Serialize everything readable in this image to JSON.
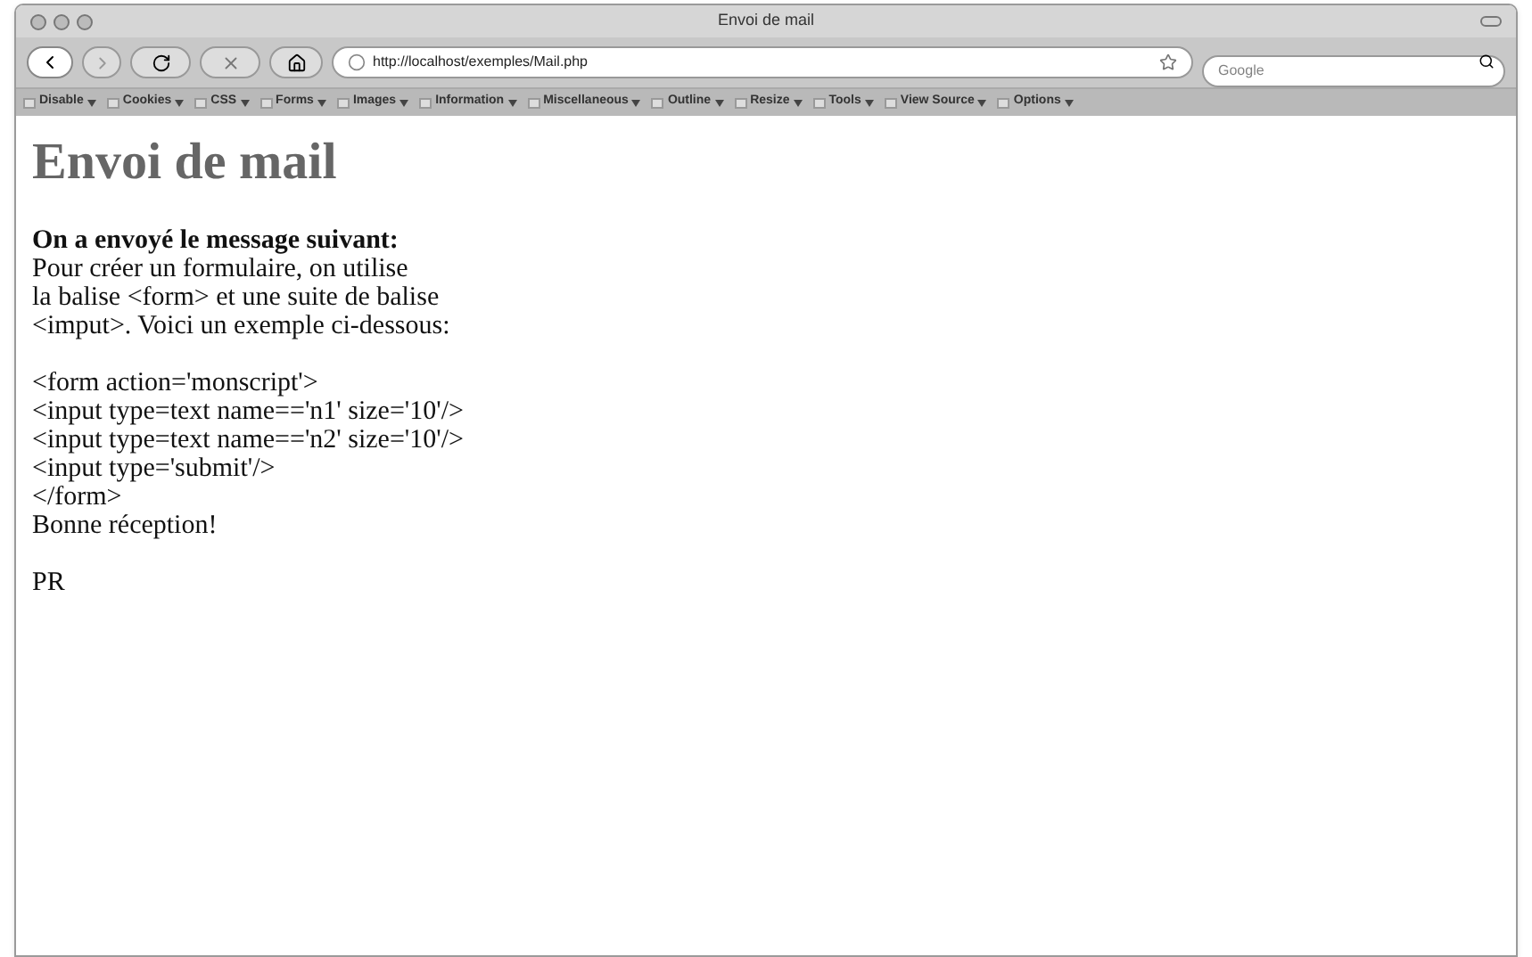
{
  "window": {
    "title": "Envoi de mail"
  },
  "address_bar": {
    "url": "http://localhost/exemples/Mail.php"
  },
  "search": {
    "placeholder": "Google"
  },
  "toolbar": [
    {
      "label": "Disable"
    },
    {
      "label": "Cookies"
    },
    {
      "label": "CSS"
    },
    {
      "label": "Forms"
    },
    {
      "label": "Images"
    },
    {
      "label": "Information"
    },
    {
      "label": "Miscellaneous"
    },
    {
      "label": "Outline"
    },
    {
      "label": "Resize"
    },
    {
      "label": "Tools"
    },
    {
      "label": "View Source"
    },
    {
      "label": "Options"
    }
  ],
  "page": {
    "heading": "Envoi de mail",
    "intro": "On a envoyé le message suivant:",
    "paragraphs": [
      [
        "Pour créer un formulaire, on utilise",
        "la balise <form> et une suite de balise",
        "<imput>. Voici un exemple ci-dessous:"
      ],
      [
        "<form action='monscript'>",
        "<input type=text name=='n1' size='10'/>",
        "<input type=text name=='n2' size='10'/>",
        "<input type='submit'/>",
        "</form>",
        "Bonne réception!"
      ],
      [
        "PR"
      ]
    ]
  }
}
